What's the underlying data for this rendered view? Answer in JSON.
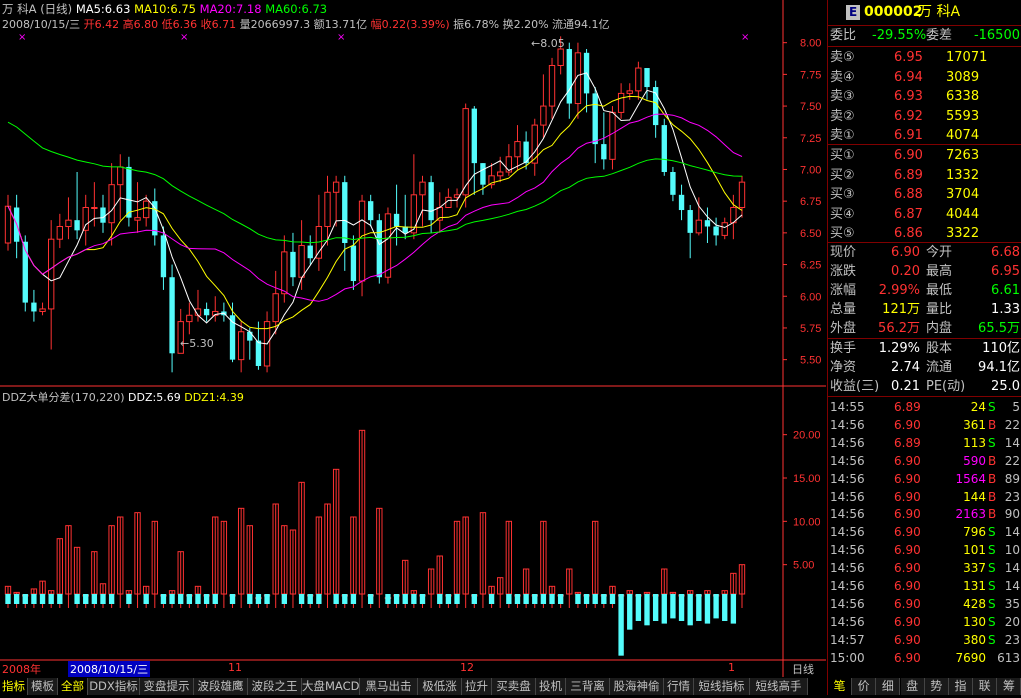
{
  "header": {
    "stock": "万 科A",
    "period": "(日线)",
    "ma5": "MA5:6.63",
    "ma10": "MA10:6.75",
    "ma20": "MA20:7.18",
    "ma60": "MA60:6.73",
    "date": "2008/10/15/三",
    "open": "开6.42",
    "high": "高6.80",
    "low": "低6.36",
    "close": "收6.71",
    "vol": "量2066997.3",
    "amt": "额13.71亿",
    "chg": "幅0.22(3.39%)",
    "amp": "振6.78%",
    "turn": "换2.20%",
    "float": "流通94.1亿",
    "max_label": "8.05",
    "min_label": "5.30"
  },
  "colors": {
    "up": "#ff3232",
    "down": "#54fcfc",
    "ma5": "#ffffff",
    "ma10": "#ffff00",
    "ma20": "#ff00ff",
    "ma60": "#00ff00",
    "axis": "#ff3232"
  },
  "price_axis": [
    "8.00",
    "7.75",
    "7.50",
    "7.25",
    "7.00",
    "6.75",
    "6.50",
    "6.25",
    "6.00",
    "5.75",
    "5.50"
  ],
  "ddz_axis": [
    "20.00",
    "15.00",
    "10.00",
    "5.00"
  ],
  "ddz_header": {
    "title": "DDZ大单分差(170,220)",
    "ddz": "DDZ:5.69",
    "ddz1": "DDZ1:4.39"
  },
  "x_axis": {
    "year": "2008年",
    "cursor_date": "2008/10/15/三",
    "m11": "11",
    "m12": "12",
    "m1": "1",
    "period_btn": "日线"
  },
  "chart_data": {
    "type": "candlestick",
    "ylim": [
      5.3,
      8.1
    ],
    "candles": [
      [
        6.42,
        6.71,
        6.36,
        6.8
      ],
      [
        6.7,
        6.43,
        6.3,
        6.8
      ],
      [
        6.43,
        5.95,
        5.88,
        6.48
      ],
      [
        5.95,
        5.88,
        5.8,
        6.05
      ],
      [
        5.88,
        5.9,
        5.85,
        5.95
      ],
      [
        5.9,
        6.45,
        5.58,
        6.6
      ],
      [
        6.45,
        6.55,
        6.38,
        6.65
      ],
      [
        6.55,
        6.6,
        6.45,
        6.78
      ],
      [
        6.6,
        6.52,
        6.45,
        6.98
      ],
      [
        6.52,
        6.7,
        6.4,
        6.8
      ],
      [
        6.7,
        6.7,
        6.55,
        6.9
      ],
      [
        6.7,
        6.58,
        6.5,
        6.8
      ],
      [
        6.58,
        6.88,
        6.4,
        7.05
      ],
      [
        6.88,
        7.02,
        6.6,
        7.12
      ],
      [
        7.02,
        6.62,
        6.55,
        7.1
      ],
      [
        6.6,
        6.62,
        6.5,
        6.9
      ],
      [
        6.62,
        6.75,
        6.55,
        6.8
      ],
      [
        6.75,
        6.48,
        6.4,
        6.85
      ],
      [
        6.48,
        6.15,
        6.05,
        6.55
      ],
      [
        6.15,
        5.55,
        5.4,
        6.25
      ],
      [
        5.55,
        5.8,
        5.55,
        5.9
      ],
      [
        5.8,
        5.85,
        5.7,
        5.95
      ],
      [
        5.85,
        5.9,
        5.8,
        6.05
      ],
      [
        5.9,
        5.85,
        5.8,
        5.95
      ],
      [
        5.85,
        5.88,
        5.8,
        6.0
      ],
      [
        5.88,
        5.85,
        5.8,
        5.95
      ],
      [
        5.85,
        5.5,
        5.48,
        5.95
      ],
      [
        5.5,
        5.72,
        5.4,
        5.8
      ],
      [
        5.72,
        5.65,
        5.5,
        5.75
      ],
      [
        5.65,
        5.45,
        5.42,
        5.8
      ],
      [
        5.45,
        5.8,
        5.4,
        5.88
      ],
      [
        5.8,
        6.02,
        5.7,
        6.2
      ],
      [
        6.02,
        6.35,
        5.95,
        6.48
      ],
      [
        6.35,
        6.15,
        6.08,
        6.5
      ],
      [
        6.15,
        6.4,
        6.05,
        6.6
      ],
      [
        6.4,
        6.3,
        6.25,
        6.48
      ],
      [
        6.3,
        6.55,
        6.2,
        6.8
      ],
      [
        6.55,
        6.82,
        6.4,
        6.95
      ],
      [
        6.82,
        6.9,
        6.55,
        6.95
      ],
      [
        6.9,
        6.42,
        6.2,
        6.95
      ],
      [
        6.4,
        6.12,
        6.05,
        6.48
      ],
      [
        6.12,
        6.75,
        6.0,
        6.8
      ],
      [
        6.75,
        6.6,
        6.55,
        6.8
      ],
      [
        6.6,
        6.15,
        6.1,
        6.65
      ],
      [
        6.15,
        6.65,
        6.1,
        6.7
      ],
      [
        6.65,
        6.55,
        6.4,
        6.88
      ],
      [
        6.55,
        6.5,
        6.45,
        6.8
      ],
      [
        6.5,
        6.8,
        6.45,
        7.12
      ],
      [
        6.8,
        6.9,
        6.55,
        6.95
      ],
      [
        6.9,
        6.6,
        6.5,
        6.95
      ],
      [
        6.6,
        6.7,
        6.5,
        6.82
      ],
      [
        6.7,
        6.78,
        6.7,
        6.85
      ],
      [
        6.78,
        6.8,
        6.7,
        6.85
      ],
      [
        6.8,
        7.48,
        6.7,
        7.52
      ],
      [
        7.48,
        7.05,
        6.8,
        7.5
      ],
      [
        7.05,
        6.88,
        6.8,
        7.05
      ],
      [
        6.88,
        6.95,
        6.85,
        7.05
      ],
      [
        6.95,
        6.98,
        6.9,
        7.1
      ],
      [
        6.98,
        7.1,
        6.95,
        7.2
      ],
      [
        7.1,
        7.22,
        7.0,
        7.35
      ],
      [
        7.22,
        7.05,
        7.0,
        7.3
      ],
      [
        7.05,
        7.35,
        6.95,
        7.4
      ],
      [
        7.35,
        7.5,
        7.25,
        7.75
      ],
      [
        7.5,
        7.82,
        7.4,
        7.88
      ],
      [
        7.82,
        7.95,
        7.75,
        8.05
      ],
      [
        7.95,
        7.52,
        7.4,
        8.0
      ],
      [
        7.52,
        7.92,
        7.4,
        8.0
      ],
      [
        7.92,
        7.6,
        7.45,
        7.95
      ],
      [
        7.6,
        7.2,
        7.05,
        7.65
      ],
      [
        7.2,
        7.08,
        7.0,
        7.45
      ],
      [
        7.08,
        7.45,
        7.0,
        7.5
      ],
      [
        7.45,
        7.6,
        7.4,
        7.68
      ],
      [
        7.6,
        7.62,
        7.55,
        7.68
      ],
      [
        7.62,
        7.8,
        7.55,
        7.85
      ],
      [
        7.8,
        7.65,
        7.55,
        7.78
      ],
      [
        7.65,
        7.35,
        7.25,
        7.7
      ],
      [
        7.35,
        6.98,
        6.95,
        7.4
      ],
      [
        6.98,
        6.8,
        6.75,
        7.02
      ],
      [
        6.8,
        6.68,
        6.6,
        6.88
      ],
      [
        6.68,
        6.5,
        6.3,
        6.72
      ],
      [
        6.5,
        6.6,
        6.48,
        6.78
      ],
      [
        6.6,
        6.55,
        6.42,
        6.7
      ],
      [
        6.55,
        6.48,
        6.4,
        6.62
      ],
      [
        6.48,
        6.58,
        6.45,
        6.62
      ],
      [
        6.58,
        6.7,
        6.45,
        6.8
      ],
      [
        6.7,
        6.9,
        6.62,
        6.95
      ]
    ],
    "ddz": [
      2.5,
      1.8,
      1.5,
      2.2,
      3.1,
      2.0,
      8.0,
      9.5,
      7.0,
      1.5,
      6.5,
      2.8,
      9.5,
      10.5,
      2.0,
      11.0,
      2.5,
      10.0,
      1.5,
      2.0,
      6.5,
      1.5,
      2.5,
      1.5,
      10.5,
      10.0,
      1.5,
      11.5,
      9.5,
      1.2,
      1.5,
      12.0,
      9.5,
      9.0,
      14.5,
      1.5,
      10.5,
      12.0,
      16.0,
      1.5,
      10.5,
      20.5,
      1.5,
      11.5,
      1.2,
      1.5,
      5.5,
      2.0,
      1.5,
      4.5,
      6.0,
      1.5,
      10.0,
      10.5,
      1.5,
      11.0,
      2.5,
      3.5,
      10.0,
      1.5,
      4.5,
      1.5,
      10.0,
      2.5,
      1.5,
      4.5,
      1.8,
      1.5,
      10.0,
      1.5,
      2.5,
      1.5,
      2.0,
      1.5,
      1.8,
      1.5,
      4.5,
      1.8,
      1.5,
      2.0,
      1.5,
      2.0,
      1.5,
      2.0,
      4.0,
      5.0
    ],
    "ddz_neg": [
      0,
      0,
      0,
      0,
      0,
      0,
      0,
      0,
      0,
      0,
      0,
      0,
      0,
      0,
      0,
      0,
      0,
      0,
      0,
      0,
      0,
      0,
      0,
      0,
      0,
      0,
      0,
      0,
      0,
      0,
      0,
      0,
      0,
      0,
      0,
      0,
      0,
      0,
      0,
      0,
      0,
      0,
      0,
      0,
      0,
      0,
      0,
      0,
      0,
      0,
      0,
      0,
      0,
      0,
      0,
      0,
      0,
      0,
      0,
      0,
      0,
      0,
      0,
      0,
      0,
      0,
      0,
      0,
      0,
      0,
      0,
      5.5,
      2.5,
      1.5,
      2.0,
      1.5,
      1.8,
      1.2,
      1.5,
      2.0,
      1.5,
      1.8,
      1.2,
      1.5,
      1.8,
      0,
      1.5
    ],
    "ddz_ylim": [
      -6,
      24
    ]
  },
  "quote": {
    "badge": "E",
    "code": "000002",
    "name": "万  科A",
    "wb_label": "委比",
    "wb_val": "-29.55%",
    "wc_label": "委差",
    "wc_val": "-16500",
    "sells": [
      {
        "l": "卖⑤",
        "p": "6.95",
        "v": "17071"
      },
      {
        "l": "卖④",
        "p": "6.94",
        "v": "3089"
      },
      {
        "l": "卖③",
        "p": "6.93",
        "v": "6338"
      },
      {
        "l": "卖②",
        "p": "6.92",
        "v": "5593"
      },
      {
        "l": "卖①",
        "p": "6.91",
        "v": "4074"
      }
    ],
    "buys": [
      {
        "l": "买①",
        "p": "6.90",
        "v": "7263"
      },
      {
        "l": "买②",
        "p": "6.89",
        "v": "1332"
      },
      {
        "l": "买③",
        "p": "6.88",
        "v": "3704"
      },
      {
        "l": "买④",
        "p": "6.87",
        "v": "4044"
      },
      {
        "l": "买⑤",
        "p": "6.86",
        "v": "3322"
      }
    ],
    "stats": [
      [
        "现价",
        "6.90",
        "今开",
        "6.68"
      ],
      [
        "涨跌",
        "0.20",
        "最高",
        "6.95"
      ],
      [
        "涨幅",
        "2.99%",
        "最低",
        "6.61"
      ],
      [
        "总量",
        "121万",
        "量比",
        "1.33"
      ],
      [
        "外盘",
        "56.2万",
        "内盘",
        "65.5万"
      ]
    ],
    "stats2": [
      [
        "换手",
        "1.29%",
        "股本",
        "110亿"
      ],
      [
        "净资",
        "2.74",
        "流通",
        "94.1亿"
      ],
      [
        "收益(三)",
        "0.21",
        "PE(动)",
        "25.0"
      ]
    ],
    "ticks": [
      [
        "14:55",
        "6.89",
        "24",
        "S",
        "5"
      ],
      [
        "14:56",
        "6.90",
        "361",
        "B",
        "22"
      ],
      [
        "14:56",
        "6.89",
        "113",
        "S",
        "14"
      ],
      [
        "14:56",
        "6.90",
        "590",
        "B",
        "22"
      ],
      [
        "14:56",
        "6.90",
        "1564",
        "B",
        "89"
      ],
      [
        "14:56",
        "6.90",
        "144",
        "B",
        "23"
      ],
      [
        "14:56",
        "6.90",
        "2163",
        "B",
        "90"
      ],
      [
        "14:56",
        "6.90",
        "796",
        "S",
        "14"
      ],
      [
        "14:56",
        "6.90",
        "101",
        "S",
        "10"
      ],
      [
        "14:56",
        "6.90",
        "337",
        "S",
        "14"
      ],
      [
        "14:56",
        "6.90",
        "131",
        "S",
        "14"
      ],
      [
        "14:56",
        "6.90",
        "428",
        "S",
        "35"
      ],
      [
        "14:56",
        "6.90",
        "130",
        "S",
        "20"
      ],
      [
        "14:57",
        "6.90",
        "380",
        "S",
        "23"
      ],
      [
        "15:00",
        "6.90",
        "7690",
        "",
        "613"
      ]
    ]
  },
  "tabs": [
    "指标",
    "模板",
    "全部",
    "DDX指标",
    "变盘提示",
    "波段雄鹰",
    "波段之王",
    "大盘MACD",
    "黑马出击",
    "极低涨",
    "拉升",
    "买卖盘",
    "投机",
    "三背离",
    "股海神偷",
    "行情",
    "短线指标",
    "短线高手"
  ],
  "bottom_tabs": [
    "笔",
    "价",
    "细",
    "盘",
    "势",
    "指",
    "联",
    "筹"
  ]
}
